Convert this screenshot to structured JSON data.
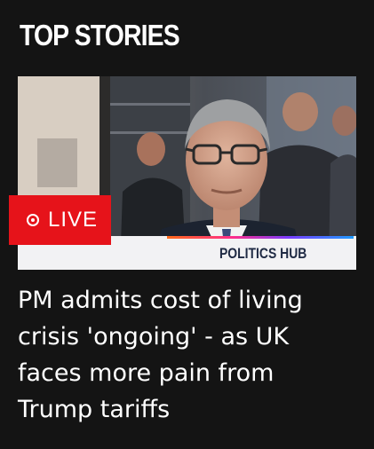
{
  "section": {
    "title": "TOP STORIES"
  },
  "story": {
    "live_label": "LIVE",
    "hub_label": "POLITICS HUB",
    "headline": "PM admits cost of living\ncrisis 'ongoing' - as UK\nfaces more pain  from\nTrump tariffs"
  },
  "colors": {
    "background": "#141414",
    "live_red": "#e6131a",
    "hub_bar": "#f2f2f4",
    "hub_text": "#1f2a44"
  },
  "icons": {
    "live_indicator": "live-dot-icon"
  }
}
